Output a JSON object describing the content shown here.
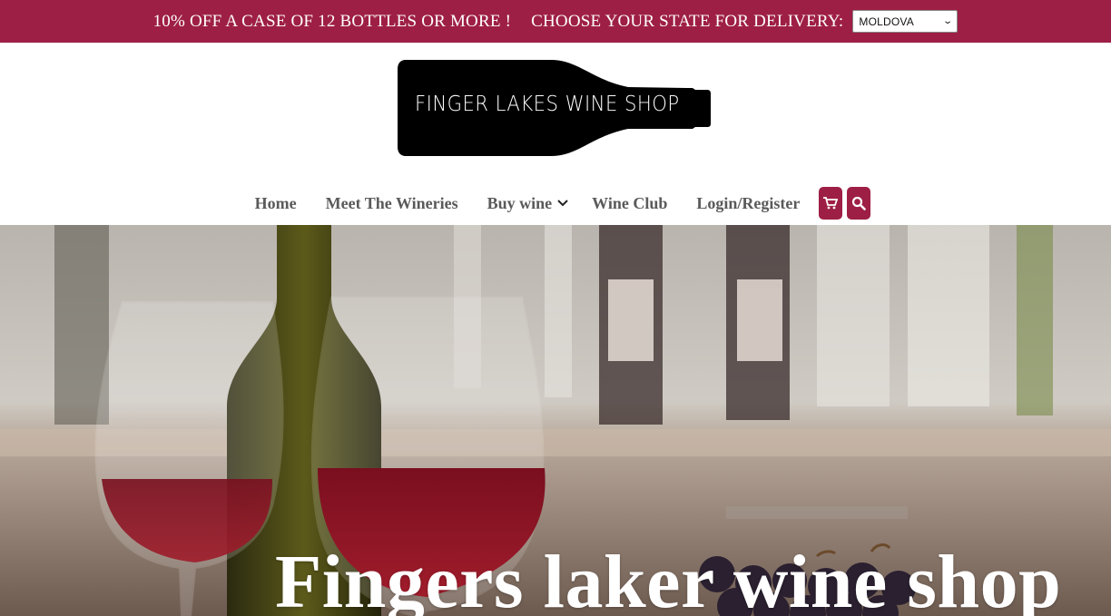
{
  "topbar": {
    "promo": "10% OFF A CASE OF 12 BOTTLES OR MORE !",
    "choose_state_label": "CHOOSE YOUR STATE FOR DELIVERY:",
    "state_selected": "MOLDOVA"
  },
  "logo": {
    "text": "FINGER LAKES WINE SHOP"
  },
  "nav": {
    "items": [
      {
        "label": "Home"
      },
      {
        "label": "Meet The Wineries"
      },
      {
        "label": "Buy wine"
      },
      {
        "label": "Wine Club"
      },
      {
        "label": "Login/Register"
      }
    ],
    "cart_icon": "cart-icon",
    "search_icon": "search-icon"
  },
  "hero": {
    "title": "Fingers laker wine shop"
  },
  "colors": {
    "brand": "#9e1f45",
    "nav_text": "#5a5a5a",
    "white": "#ffffff"
  }
}
